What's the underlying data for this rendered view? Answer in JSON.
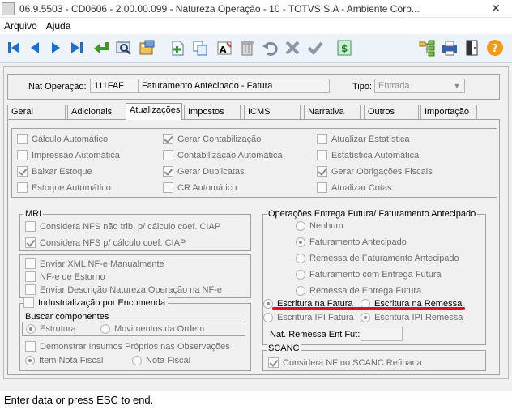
{
  "window": {
    "title": "06.9.5503 - CD0606 - 2.00.00.099 - Natureza Operação - 10 - TOTVS S.A - Ambiente Corp..."
  },
  "menu": [
    "Arquivo",
    "Ajuda"
  ],
  "toolbar": {
    "buttons": [
      "first-record-icon",
      "previous-record-icon",
      "next-record-icon",
      "last-record-icon",
      "return-icon",
      "search-icon",
      "calculator-icon",
      "new-record-icon",
      "copy-record-icon",
      "edit-text-icon",
      "delete-icon",
      "undo-icon",
      "cancel-icon",
      "confirm-icon",
      "currency-icon",
      "tree-icon",
      "print-icon",
      "exit-icon",
      "help-icon"
    ]
  },
  "header": {
    "nat_operacao_label": "Nat Operação:",
    "nat_operacao_code": "111FAF",
    "nat_operacao_desc": "Faturamento Antecipado - Fatura",
    "tipo_label": "Tipo:",
    "tipo_value": "Entrada"
  },
  "tabs": [
    "Geral",
    "Adicionais",
    "Atualizações",
    "Impostos",
    "ICMS",
    "Narrativa",
    "Outros",
    "Importação"
  ],
  "active_tab": "Atualizações",
  "updates": {
    "col1": [
      {
        "label": "Cálculo Automático",
        "checked": false
      },
      {
        "label": "Impressão Automática",
        "checked": false
      },
      {
        "label": "Baixar Estoque",
        "checked": true
      },
      {
        "label": "Estoque Automático",
        "checked": false
      }
    ],
    "col2": [
      {
        "label": "Gerar Contabilização",
        "checked": true
      },
      {
        "label": "Contabilização Automática",
        "checked": false
      },
      {
        "label": "Gerar Duplicatas",
        "checked": true
      },
      {
        "label": "CR Automático",
        "checked": false
      }
    ],
    "col3": [
      {
        "label": "Atualizar Estatística",
        "checked": false
      },
      {
        "label": "Estatística Automática",
        "checked": false
      },
      {
        "label": "Gerar Obrigações Fiscais",
        "checked": true
      },
      {
        "label": "Atualizar Cotas",
        "checked": false
      }
    ]
  },
  "mri": {
    "title": "MRI",
    "items": [
      {
        "label": "Considera NFS não trib. p/ cálculo coef. CIAP",
        "checked": false
      },
      {
        "label": "Considera NFS p/ cálculo coef. CIAP",
        "checked": true
      }
    ]
  },
  "nfe": {
    "items": [
      {
        "label": "Enviar XML NF-e Manualmente",
        "checked": false
      },
      {
        "label": "NF-e de Estorno",
        "checked": false
      },
      {
        "label": "Enviar Descrição Natureza Operação na NF-e",
        "checked": false
      }
    ]
  },
  "industrializacao": {
    "label": "Industrialização por Encomenda",
    "buscar_title": "Buscar componentes",
    "buscar_options": [
      "Estrutura",
      "Movimentos da Ordem"
    ],
    "buscar_selected": "Estrutura",
    "demonstrar_label": "Demonstrar Insumos Próprios nas Observações",
    "item_options": [
      "Item Nota Fiscal",
      "Nota Fiscal"
    ],
    "item_selected": "Item Nota Fiscal"
  },
  "entrega_futura": {
    "title": "Operações Entrega Futura/ Faturamento Antecipado",
    "options": [
      "Nenhum",
      "Faturamento Antecipado",
      "Remessa de Faturamento Antecipado",
      "Faturamento com Entrega Futura",
      "Remessa de Entrega Futura"
    ],
    "selected": "Faturamento Antecipado",
    "escritura_options": [
      "Escritura na Fatura",
      "Escritura na Remessa"
    ],
    "escritura_ipi_options": [
      "Escritura IPI Fatura",
      "Escritura IPI Remessa"
    ],
    "nat_remessa_label": "Nat. Remessa Ent Fut:",
    "nat_remessa_value": ""
  },
  "scanc": {
    "title": "SCANC",
    "label": "Considera NF no SCANC Refinaria",
    "checked": true
  },
  "status": "Enter data or press ESC to end."
}
